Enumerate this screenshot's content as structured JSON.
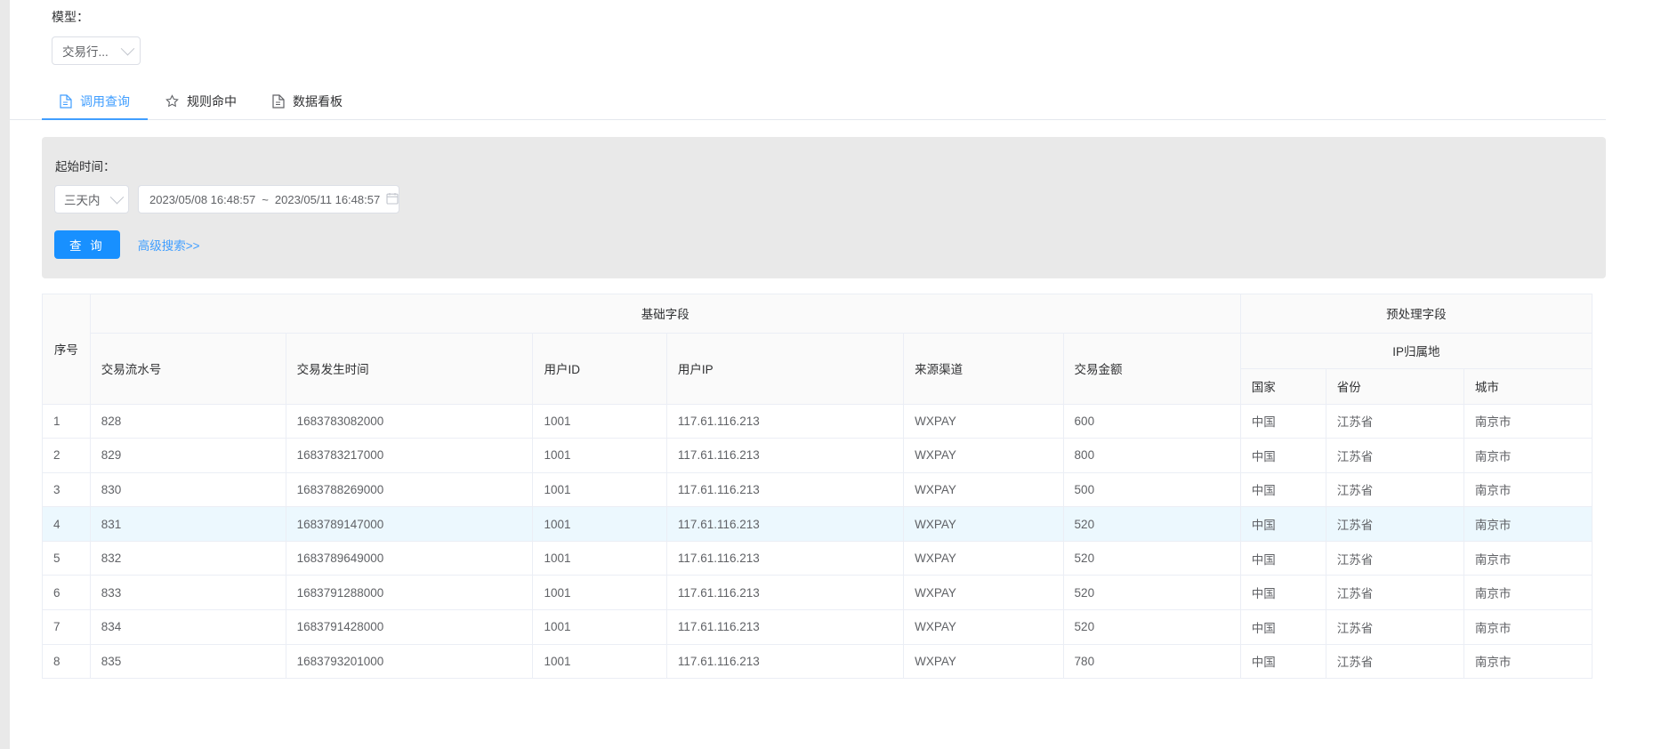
{
  "model": {
    "label": "模型：",
    "selected": "交易行...",
    "caret_icon": "chevron-down-icon"
  },
  "tabs": [
    {
      "label": "调用查询",
      "icon": "document-icon",
      "active": true
    },
    {
      "label": "规则命中",
      "icon": "pushpin-icon",
      "active": false
    },
    {
      "label": "数据看板",
      "icon": "document-icon",
      "active": false
    }
  ],
  "search": {
    "time_label": "起始时间：",
    "range_preset": "三天内",
    "preset_caret_icon": "chevron-down-icon",
    "date_start": "2023/05/08 16:48:57",
    "date_sep": "~",
    "date_end": "2023/05/11 16:48:57",
    "calendar_icon": "calendar-icon",
    "query_button": "查 询",
    "advanced_link": "高级搜索>>"
  },
  "table": {
    "group_headers": {
      "seq": "序号",
      "basic": "基础字段",
      "pre": "预处理字段"
    },
    "sub_group": {
      "ip_region": "IP归属地"
    },
    "columns": {
      "serial": "交易流水号",
      "time": "交易发生时间",
      "user_id": "用户ID",
      "user_ip": "用户IP",
      "channel": "来源渠道",
      "amount": "交易金额",
      "country": "国家",
      "province": "省份",
      "city": "城市"
    },
    "rows": [
      {
        "no": "1",
        "serial": "828",
        "time": "1683783082000",
        "user_id": "1001",
        "user_ip": "117.61.116.213",
        "channel": "WXPAY",
        "amount": "600",
        "country": "中国",
        "province": "江苏省",
        "city": "南京市",
        "highlight": false
      },
      {
        "no": "2",
        "serial": "829",
        "time": "1683783217000",
        "user_id": "1001",
        "user_ip": "117.61.116.213",
        "channel": "WXPAY",
        "amount": "800",
        "country": "中国",
        "province": "江苏省",
        "city": "南京市",
        "highlight": false
      },
      {
        "no": "3",
        "serial": "830",
        "time": "1683788269000",
        "user_id": "1001",
        "user_ip": "117.61.116.213",
        "channel": "WXPAY",
        "amount": "500",
        "country": "中国",
        "province": "江苏省",
        "city": "南京市",
        "highlight": false
      },
      {
        "no": "4",
        "serial": "831",
        "time": "1683789147000",
        "user_id": "1001",
        "user_ip": "117.61.116.213",
        "channel": "WXPAY",
        "amount": "520",
        "country": "中国",
        "province": "江苏省",
        "city": "南京市",
        "highlight": true
      },
      {
        "no": "5",
        "serial": "832",
        "time": "1683789649000",
        "user_id": "1001",
        "user_ip": "117.61.116.213",
        "channel": "WXPAY",
        "amount": "520",
        "country": "中国",
        "province": "江苏省",
        "city": "南京市",
        "highlight": false
      },
      {
        "no": "6",
        "serial": "833",
        "time": "1683791288000",
        "user_id": "1001",
        "user_ip": "117.61.116.213",
        "channel": "WXPAY",
        "amount": "520",
        "country": "中国",
        "province": "江苏省",
        "city": "南京市",
        "highlight": false
      },
      {
        "no": "7",
        "serial": "834",
        "time": "1683791428000",
        "user_id": "1001",
        "user_ip": "117.61.116.213",
        "channel": "WXPAY",
        "amount": "520",
        "country": "中国",
        "province": "江苏省",
        "city": "南京市",
        "highlight": false
      },
      {
        "no": "8",
        "serial": "835",
        "time": "1683793201000",
        "user_id": "1001",
        "user_ip": "117.61.116.213",
        "channel": "WXPAY",
        "amount": "780",
        "country": "中国",
        "province": "江苏省",
        "city": "南京市",
        "highlight": false
      }
    ]
  },
  "colors": {
    "accent": "#409eff",
    "button": "#1890ff",
    "panel_bg": "#e9e9e9",
    "row_highlight": "#ecf8fe",
    "header_bg": "#fafafa",
    "border": "#ebeef5"
  }
}
